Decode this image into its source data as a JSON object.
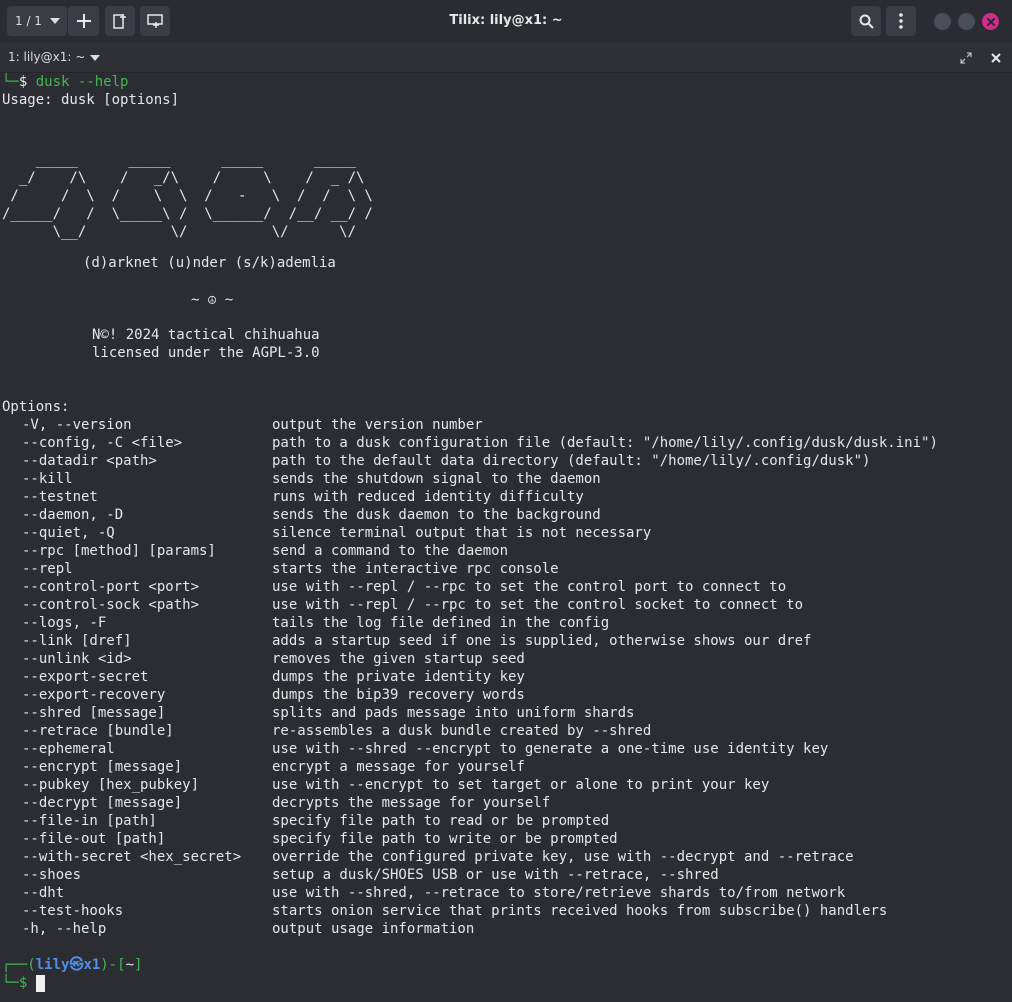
{
  "window": {
    "title": "Tilix: lily@x1: ~",
    "session_counter": "1 / 1",
    "tab_label": "1: lily@x1: ~"
  },
  "terminal": {
    "prompt_symbol": "$",
    "command": "dusk --help",
    "usage": "Usage: dusk [options]",
    "ascii_logo": [
      "    _____      _____      _____      _____",
      "  _/    /\\    /   _/\\    /     \\    /  _ /\\",
      " /     /  \\  /    \\  \\  /   -   \\  /  /  \\ \\",
      "/_____/   /  \\_____\\ /  \\______/  /__/ __/ /",
      "      \\__/          \\/          \\/      \\/"
    ],
    "tagline": "(d)arknet (u)nder (s/k)ademlia",
    "ornament": "~ ☮ ~",
    "copyright": "N©! 2024 tactical chihuahua",
    "license": "licensed under the AGPL-3.0",
    "options_header": "Options:",
    "options": [
      {
        "flag": "-V, --version",
        "desc": "output the version number"
      },
      {
        "flag": "--config, -C <file>",
        "desc": "path to a dusk configuration file (default: \"/home/lily/.config/dusk/dusk.ini\")"
      },
      {
        "flag": "--datadir <path>",
        "desc": "path to the default data directory (default: \"/home/lily/.config/dusk\")"
      },
      {
        "flag": "--kill",
        "desc": "sends the shutdown signal to the daemon"
      },
      {
        "flag": "--testnet",
        "desc": "runs with reduced identity difficulty"
      },
      {
        "flag": "--daemon, -D",
        "desc": "sends the dusk daemon to the background"
      },
      {
        "flag": "--quiet, -Q",
        "desc": "silence terminal output that is not necessary"
      },
      {
        "flag": "--rpc [method] [params]",
        "desc": "send a command to the daemon"
      },
      {
        "flag": "--repl",
        "desc": "starts the interactive rpc console"
      },
      {
        "flag": "--control-port <port>",
        "desc": "use with --repl / --rpc to set the control port to connect to"
      },
      {
        "flag": "--control-sock <path>",
        "desc": "use with --repl / --rpc to set the control socket to connect to"
      },
      {
        "flag": "--logs, -F",
        "desc": "tails the log file defined in the config"
      },
      {
        "flag": "--link [dref]",
        "desc": "adds a startup seed if one is supplied, otherwise shows our dref"
      },
      {
        "flag": "--unlink <id>",
        "desc": "removes the given startup seed"
      },
      {
        "flag": "--export-secret",
        "desc": "dumps the private identity key"
      },
      {
        "flag": "--export-recovery",
        "desc": "dumps the bip39 recovery words"
      },
      {
        "flag": "--shred [message]",
        "desc": "splits and pads message into uniform shards"
      },
      {
        "flag": "--retrace [bundle]",
        "desc": "re-assembles a dusk bundle created by --shred"
      },
      {
        "flag": "--ephemeral",
        "desc": "use with --shred --encrypt to generate a one-time use identity key"
      },
      {
        "flag": "--encrypt [message]",
        "desc": "encrypt a message for yourself"
      },
      {
        "flag": "--pubkey [hex_pubkey]",
        "desc": "use with --encrypt to set target or alone to print your key"
      },
      {
        "flag": "--decrypt [message]",
        "desc": "decrypts the message for yourself"
      },
      {
        "flag": "--file-in [path]",
        "desc": "specify file path to read or be prompted"
      },
      {
        "flag": "--file-out [path]",
        "desc": "specify file path to write or be prompted"
      },
      {
        "flag": "--with-secret <hex_secret>",
        "desc": "override the configured private key, use with --decrypt and --retrace"
      },
      {
        "flag": "--shoes",
        "desc": "setup a dusk/SHOES USB or use with --retrace, --shred"
      },
      {
        "flag": "--dht",
        "desc": "use with --shred, --retrace to store/retrieve shards to/from network"
      },
      {
        "flag": "--test-hooks",
        "desc": "starts onion service that prints received hooks from subscribe() handlers"
      },
      {
        "flag": "-h, --help",
        "desc": "output usage information"
      }
    ],
    "prompt": {
      "user": "lily",
      "symbol": "㉿",
      "host": "x1",
      "dir": "~"
    }
  },
  "colors": {
    "background": "#2b2d33",
    "prompt_green": "#3fb950",
    "prompt_blue": "#4f8fe8",
    "close_button": "#d02c8c"
  }
}
